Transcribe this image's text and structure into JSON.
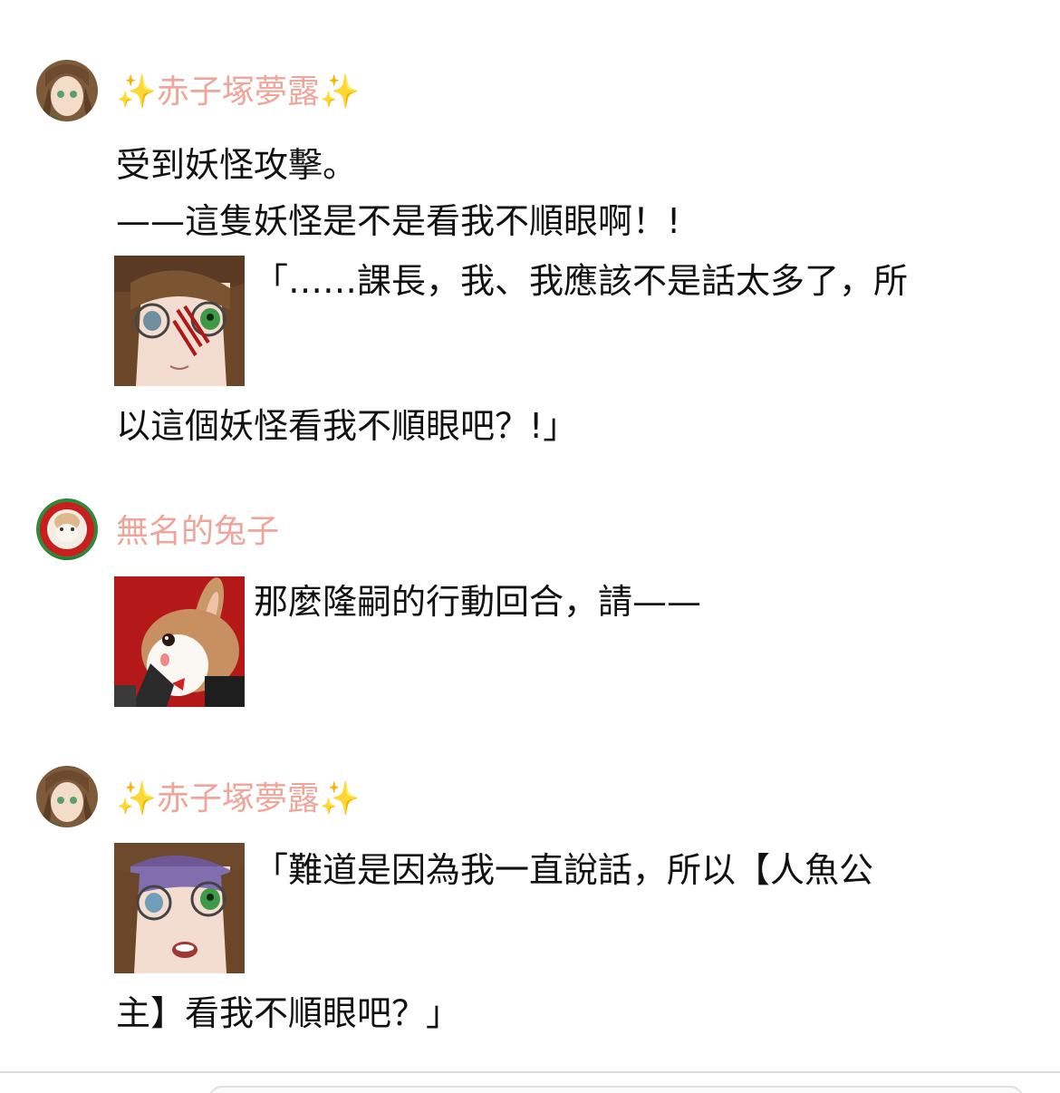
{
  "messages": [
    {
      "author": "赤子塚夢露",
      "author_decor_left": "✨",
      "author_decor_right": "✨",
      "author_color": "#f0a59a",
      "lines": [
        "受到妖怪攻擊。",
        "——這隻妖怪是不是看我不順眼啊！!"
      ],
      "portrait_line": "「……課長，我、我應該不是話太多了，所",
      "after_line": "以這個妖怪看我不順眼吧？!」"
    },
    {
      "author": "無名的兔子",
      "author_color": "#f0a59a",
      "portrait_line": "那麼隆嗣的行動回合，請——"
    },
    {
      "author": "赤子塚夢露",
      "author_decor_left": "✨",
      "author_decor_right": "✨",
      "author_color": "#f0a59a",
      "portrait_line": "「難道是因為我一直說話，所以【人魚公",
      "after_line": "主】看我不順眼吧？」"
    }
  ],
  "icons": {
    "avatar_1": "girl-avatar-icon",
    "avatar_2": "rabbit-avatar-icon",
    "portrait_1": "injured-girl-portrait",
    "portrait_2": "rabbit-portrait",
    "portrait_3": "shocked-girl-portrait"
  }
}
